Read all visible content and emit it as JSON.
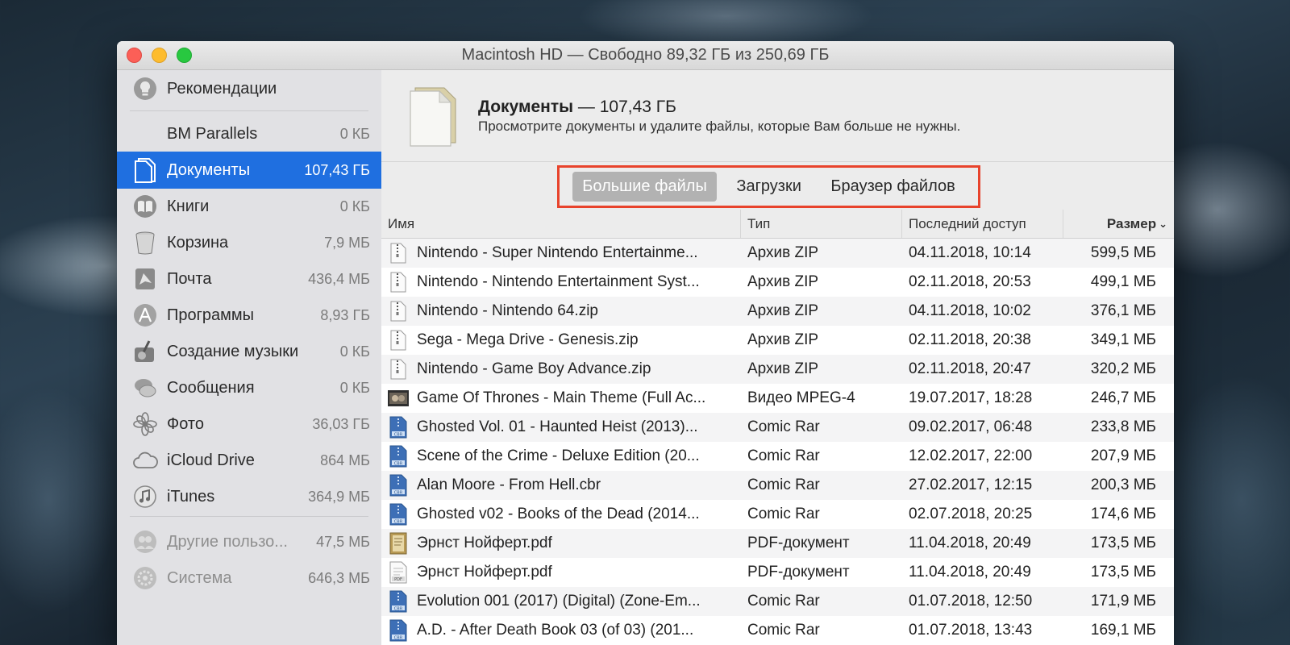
{
  "window": {
    "title": "Macintosh HD — Свободно 89,32 ГБ из 250,69 ГБ"
  },
  "sidebar": {
    "items": [
      {
        "label": "Рекомендации",
        "value": "",
        "icon": "lightbulb-icon"
      },
      {
        "label": "BM Parallels",
        "value": "0 КБ",
        "icon": ""
      },
      {
        "label": "Документы",
        "value": "107,43 ГБ",
        "icon": "document-icon",
        "active": true
      },
      {
        "label": "Книги",
        "value": "0 КБ",
        "icon": "book-icon"
      },
      {
        "label": "Корзина",
        "value": "7,9 МБ",
        "icon": "trash-icon"
      },
      {
        "label": "Почта",
        "value": "436,4 МБ",
        "icon": "mail-icon"
      },
      {
        "label": "Программы",
        "value": "8,93 ГБ",
        "icon": "apps-icon"
      },
      {
        "label": "Создание музыки",
        "value": "0 КБ",
        "icon": "guitar-icon"
      },
      {
        "label": "Сообщения",
        "value": "0 КБ",
        "icon": "messages-icon"
      },
      {
        "label": "Фото",
        "value": "36,03 ГБ",
        "icon": "photos-icon"
      },
      {
        "label": "iCloud Drive",
        "value": "864 МБ",
        "icon": "cloud-icon"
      },
      {
        "label": "iTunes",
        "value": "364,9 МБ",
        "icon": "music-icon"
      },
      {
        "label": "Другие пользо...",
        "value": "47,5 МБ",
        "icon": "users-icon"
      },
      {
        "label": "Система",
        "value": "646,3 МБ",
        "icon": "system-icon"
      }
    ]
  },
  "header": {
    "title": "Документы",
    "size": " — 107,43 ГБ",
    "subtitle": "Просмотрите документы и удалите файлы, которые Вам больше не нужны."
  },
  "segments": {
    "items": [
      "Большие файлы",
      "Загрузки",
      "Браузер файлов"
    ],
    "selected": "Большие файлы"
  },
  "table": {
    "columns": [
      "Имя",
      "Тип",
      "Последний доступ",
      "Размер"
    ],
    "rows": [
      {
        "name": "Nintendo - Super Nintendo Entertainme...",
        "type": "Архив ZIP",
        "date": "04.11.2018, 10:14",
        "size": "599,5 МБ",
        "icon": "zip"
      },
      {
        "name": "Nintendo - Nintendo Entertainment Syst...",
        "type": "Архив ZIP",
        "date": "02.11.2018, 20:53",
        "size": "499,1 МБ",
        "icon": "zip"
      },
      {
        "name": "Nintendo - Nintendo 64.zip",
        "type": "Архив ZIP",
        "date": "04.11.2018, 10:02",
        "size": "376,1 МБ",
        "icon": "zip"
      },
      {
        "name": "Sega - Mega Drive - Genesis.zip",
        "type": "Архив ZIP",
        "date": "02.11.2018, 20:38",
        "size": "349,1 МБ",
        "icon": "zip"
      },
      {
        "name": "Nintendo - Game Boy Advance.zip",
        "type": "Архив ZIP",
        "date": "02.11.2018, 20:47",
        "size": "320,2 МБ",
        "icon": "zip"
      },
      {
        "name": "Game Of Thrones - Main Theme (Full Ac...",
        "type": "Видео MPEG-4",
        "date": "19.07.2017, 18:28",
        "size": "246,7 МБ",
        "icon": "video"
      },
      {
        "name": "Ghosted Vol. 01 - Haunted Heist (2013)...",
        "type": "Comic Rar",
        "date": "09.02.2017, 06:48",
        "size": "233,8 МБ",
        "icon": "cbr"
      },
      {
        "name": "Scene of the Crime - Deluxe Edition (20...",
        "type": "Comic Rar",
        "date": "12.02.2017, 22:00",
        "size": "207,9 МБ",
        "icon": "cbr"
      },
      {
        "name": "Alan Moore - From Hell.cbr",
        "type": "Comic Rar",
        "date": "27.02.2017, 12:15",
        "size": "200,3 МБ",
        "icon": "cbr"
      },
      {
        "name": "Ghosted v02 - Books of the Dead (2014...",
        "type": "Comic Rar",
        "date": "02.07.2018, 20:25",
        "size": "174,6 МБ",
        "icon": "cbr"
      },
      {
        "name": "Эрнст Нойферт.pdf",
        "type": "PDF-документ",
        "date": "11.04.2018, 20:49",
        "size": "173,5 МБ",
        "icon": "book"
      },
      {
        "name": "Эрнст Нойферт.pdf",
        "type": "PDF-документ",
        "date": "11.04.2018, 20:49",
        "size": "173,5 МБ",
        "icon": "pdf"
      },
      {
        "name": "Evolution 001 (2017) (Digital) (Zone-Em...",
        "type": "Comic Rar",
        "date": "01.07.2018, 12:50",
        "size": "171,9 МБ",
        "icon": "cbr"
      },
      {
        "name": "A.D. - After Death Book 03 (of 03) (201...",
        "type": "Comic Rar",
        "date": "01.07.2018, 13:43",
        "size": "169,1 МБ",
        "icon": "cbr"
      }
    ]
  },
  "colors": {
    "accent": "#1f6fe0",
    "highlight_border": "#e8432c"
  }
}
